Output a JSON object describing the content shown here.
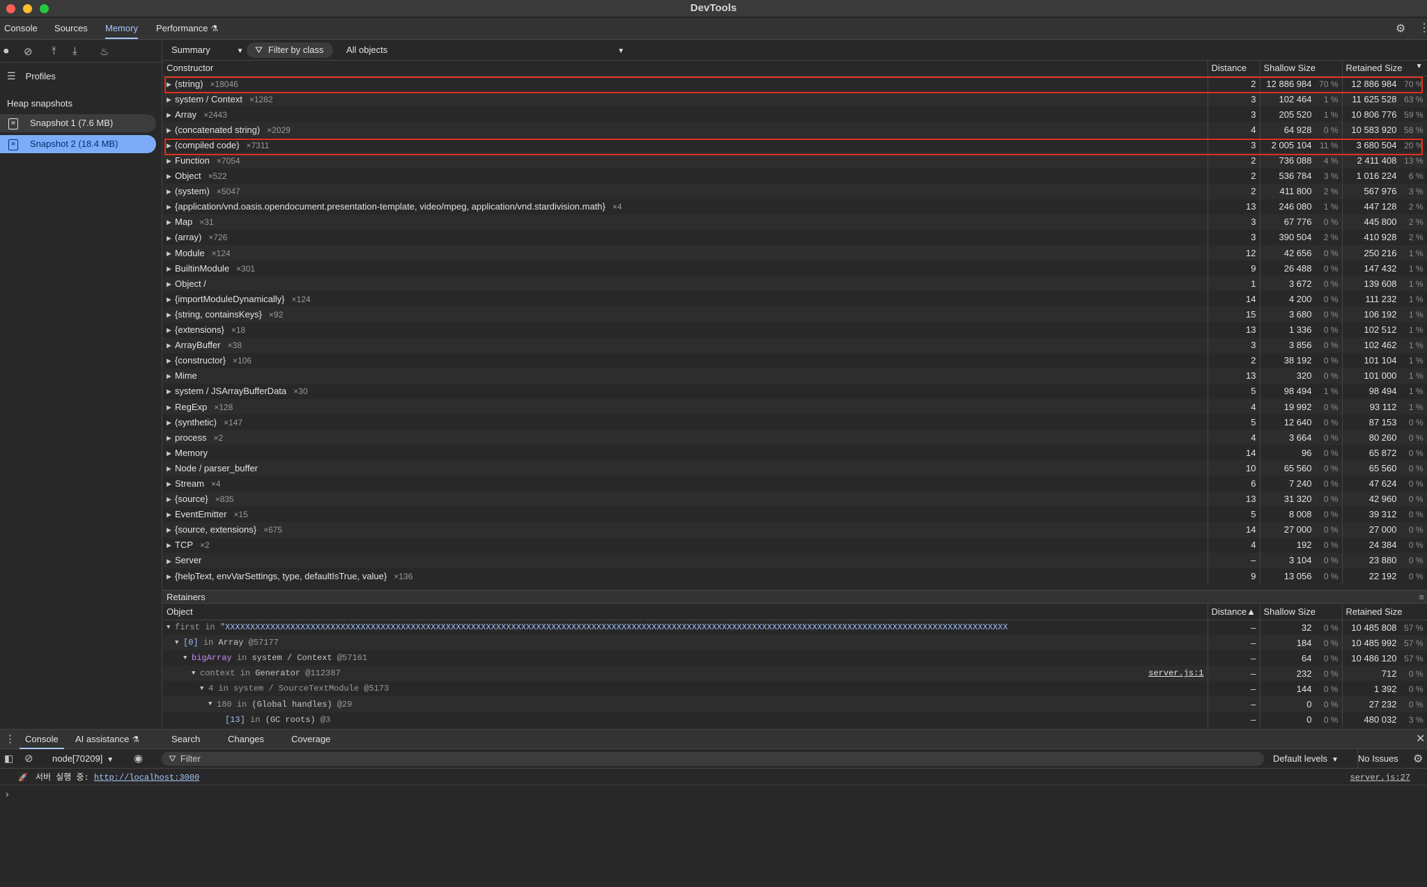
{
  "window": {
    "title": "DevTools"
  },
  "tabs": [
    "Console",
    "Sources",
    "Memory",
    "Performance"
  ],
  "sidebar": {
    "profiles_label": "Profiles",
    "heap_header": "Heap snapshots",
    "snapshots": [
      "Snapshot 1 (7.6 MB)",
      "Snapshot 2 (18.4 MB)"
    ]
  },
  "toolbar": {
    "view": "Summary",
    "filter": "Filter by class",
    "objects": "All objects"
  },
  "summary": {
    "headers": {
      "constructor": "Constructor",
      "distance": "Distance",
      "shallow": "Shallow Size",
      "retained": "Retained Size"
    },
    "rows": [
      {
        "name": "(string)",
        "count": "×18046",
        "distance": "2",
        "shallow": "12 886 984",
        "shallow_pct": "70 %",
        "retained": "12 886 984",
        "retained_pct": "70 %"
      },
      {
        "name": "system / Context",
        "count": "×1282",
        "distance": "3",
        "shallow": "102 464",
        "shallow_pct": "1 %",
        "retained": "11 625 528",
        "retained_pct": "63 %"
      },
      {
        "name": "Array",
        "count": "×2443",
        "distance": "3",
        "shallow": "205 520",
        "shallow_pct": "1 %",
        "retained": "10 806 776",
        "retained_pct": "59 %"
      },
      {
        "name": "(concatenated string)",
        "count": "×2029",
        "distance": "4",
        "shallow": "64 928",
        "shallow_pct": "0 %",
        "retained": "10 583 920",
        "retained_pct": "58 %"
      },
      {
        "name": "(compiled code)",
        "count": "×7311",
        "distance": "3",
        "shallow": "2 005 104",
        "shallow_pct": "11 %",
        "retained": "3 680 504",
        "retained_pct": "20 %"
      },
      {
        "name": "Function",
        "count": "×7054",
        "distance": "2",
        "shallow": "736 088",
        "shallow_pct": "4 %",
        "retained": "2 411 408",
        "retained_pct": "13 %"
      },
      {
        "name": "Object",
        "count": "×522",
        "distance": "2",
        "shallow": "536 784",
        "shallow_pct": "3 %",
        "retained": "1 016 224",
        "retained_pct": "6 %"
      },
      {
        "name": "(system)",
        "count": "×5047",
        "distance": "2",
        "shallow": "411 800",
        "shallow_pct": "2 %",
        "retained": "567 976",
        "retained_pct": "3 %"
      },
      {
        "name": "{application/vnd.oasis.opendocument.presentation-template, video/mpeg, application/vnd.stardivision.math}",
        "count": "×4",
        "distance": "13",
        "shallow": "246 080",
        "shallow_pct": "1 %",
        "retained": "447 128",
        "retained_pct": "2 %"
      },
      {
        "name": "Map",
        "count": "×31",
        "distance": "3",
        "shallow": "67 776",
        "shallow_pct": "0 %",
        "retained": "445 800",
        "retained_pct": "2 %"
      },
      {
        "name": "(array)",
        "count": "×726",
        "distance": "3",
        "shallow": "390 504",
        "shallow_pct": "2 %",
        "retained": "410 928",
        "retained_pct": "2 %"
      },
      {
        "name": "Module",
        "count": "×124",
        "distance": "12",
        "shallow": "42 656",
        "shallow_pct": "0 %",
        "retained": "250 216",
        "retained_pct": "1 %"
      },
      {
        "name": "BuiltinModule",
        "count": "×301",
        "distance": "9",
        "shallow": "26 488",
        "shallow_pct": "0 %",
        "retained": "147 432",
        "retained_pct": "1 %"
      },
      {
        "name": "Object /",
        "count": "",
        "distance": "1",
        "shallow": "3 672",
        "shallow_pct": "0 %",
        "retained": "139 608",
        "retained_pct": "1 %"
      },
      {
        "name": "{importModuleDynamically}",
        "count": "×124",
        "distance": "14",
        "shallow": "4 200",
        "shallow_pct": "0 %",
        "retained": "111 232",
        "retained_pct": "1 %"
      },
      {
        "name": "{string, containsKeys}",
        "count": "×92",
        "distance": "15",
        "shallow": "3 680",
        "shallow_pct": "0 %",
        "retained": "106 192",
        "retained_pct": "1 %"
      },
      {
        "name": "{extensions}",
        "count": "×18",
        "distance": "13",
        "shallow": "1 336",
        "shallow_pct": "0 %",
        "retained": "102 512",
        "retained_pct": "1 %"
      },
      {
        "name": "ArrayBuffer",
        "count": "×38",
        "distance": "3",
        "shallow": "3 856",
        "shallow_pct": "0 %",
        "retained": "102 462",
        "retained_pct": "1 %"
      },
      {
        "name": "{constructor}",
        "count": "×106",
        "distance": "2",
        "shallow": "38 192",
        "shallow_pct": "0 %",
        "retained": "101 104",
        "retained_pct": "1 %"
      },
      {
        "name": "Mime",
        "count": "",
        "distance": "13",
        "shallow": "320",
        "shallow_pct": "0 %",
        "retained": "101 000",
        "retained_pct": "1 %"
      },
      {
        "name": "system / JSArrayBufferData",
        "count": "×30",
        "distance": "5",
        "shallow": "98 494",
        "shallow_pct": "1 %",
        "retained": "98 494",
        "retained_pct": "1 %"
      },
      {
        "name": "RegExp",
        "count": "×128",
        "distance": "4",
        "shallow": "19 992",
        "shallow_pct": "0 %",
        "retained": "93 112",
        "retained_pct": "1 %"
      },
      {
        "name": "(synthetic)",
        "count": "×147",
        "distance": "5",
        "shallow": "12 640",
        "shallow_pct": "0 %",
        "retained": "87 153",
        "retained_pct": "0 %"
      },
      {
        "name": "process",
        "count": "×2",
        "distance": "4",
        "shallow": "3 664",
        "shallow_pct": "0 %",
        "retained": "80 260",
        "retained_pct": "0 %"
      },
      {
        "name": "Memory",
        "count": "",
        "distance": "14",
        "shallow": "96",
        "shallow_pct": "0 %",
        "retained": "65 872",
        "retained_pct": "0 %"
      },
      {
        "name": "Node / parser_buffer",
        "count": "",
        "distance": "10",
        "shallow": "65 560",
        "shallow_pct": "0 %",
        "retained": "65 560",
        "retained_pct": "0 %"
      },
      {
        "name": "Stream",
        "count": "×4",
        "distance": "6",
        "shallow": "7 240",
        "shallow_pct": "0 %",
        "retained": "47 624",
        "retained_pct": "0 %"
      },
      {
        "name": "{source}",
        "count": "×835",
        "distance": "13",
        "shallow": "31 320",
        "shallow_pct": "0 %",
        "retained": "42 960",
        "retained_pct": "0 %"
      },
      {
        "name": "EventEmitter",
        "count": "×15",
        "distance": "5",
        "shallow": "8 008",
        "shallow_pct": "0 %",
        "retained": "39 312",
        "retained_pct": "0 %"
      },
      {
        "name": "{source, extensions}",
        "count": "×675",
        "distance": "14",
        "shallow": "27 000",
        "shallow_pct": "0 %",
        "retained": "27 000",
        "retained_pct": "0 %"
      },
      {
        "name": "TCP",
        "count": "×2",
        "distance": "4",
        "shallow": "192",
        "shallow_pct": "0 %",
        "retained": "24 384",
        "retained_pct": "0 %"
      },
      {
        "name": "Server",
        "count": "",
        "distance": "–",
        "shallow": "3 104",
        "shallow_pct": "0 %",
        "retained": "23 880",
        "retained_pct": "0 %"
      },
      {
        "name": "{helpText, envVarSettings, type, defaultIsTrue, value}",
        "count": "×136",
        "distance": "9",
        "shallow": "13 056",
        "shallow_pct": "0 %",
        "retained": "22 192",
        "retained_pct": "0 %"
      }
    ]
  },
  "retainers": {
    "title": "Retainers",
    "headers": {
      "object": "Object",
      "distance": "Distance▲",
      "shallow": "Shallow Size",
      "retained": "Retained Size"
    },
    "rows": [
      {
        "key": "first",
        "in": "in",
        "target": "\"XXXXXXXXXXXXXXXXXXXXXXXXXXXXXXXXXXXXXXXXXXXXXXXXXXXXXXXXXXXXXXXXXXXXXXXXXXXXXXXXXXXXXXXXXXXXXXXXXXXXXXXXXXXXXXXXXXXXXXXXXXXXXXXXXXXXXXXXXXXXXXXXXXXXXXXXXXXX",
        "id": "",
        "src": "",
        "distance": "–",
        "shallow": "32",
        "shallow_pct": "0 %",
        "retained": "10 485 808",
        "retained_pct": "57 %"
      },
      {
        "key": "[0]",
        "in": "in",
        "target": "Array",
        "id": "@57177",
        "src": "",
        "distance": "–",
        "shallow": "184",
        "shallow_pct": "0 %",
        "retained": "10 485 992",
        "retained_pct": "57 %"
      },
      {
        "key": "bigArray",
        "in": "in",
        "target": "system / Context",
        "id": "@57161",
        "src": "",
        "distance": "–",
        "shallow": "64",
        "shallow_pct": "0 %",
        "retained": "10 486 120",
        "retained_pct": "57 %"
      },
      {
        "key": "context",
        "in": "in",
        "target": "Generator",
        "id": "@112387",
        "src": "server.js:1",
        "distance": "–",
        "shallow": "232",
        "shallow_pct": "0 %",
        "retained": "712",
        "retained_pct": "0 %"
      },
      {
        "key": "4",
        "in": "in",
        "target": "system / SourceTextModule",
        "id": "@5173",
        "src": "",
        "distance": "–",
        "shallow": "144",
        "shallow_pct": "0 %",
        "retained": "1 392",
        "retained_pct": "0 %"
      },
      {
        "key": "180",
        "in": "in",
        "target": "(Global handles)",
        "id": "@29",
        "src": "",
        "distance": "–",
        "shallow": "0",
        "shallow_pct": "0 %",
        "retained": "27 232",
        "retained_pct": "0 %"
      },
      {
        "key": "[13]",
        "in": "in",
        "target": "(GC roots)",
        "id": "@3",
        "src": "",
        "distance": "–",
        "shallow": "0",
        "shallow_pct": "0 %",
        "retained": "480 032",
        "retained_pct": "3 %"
      }
    ]
  },
  "drawer": {
    "tabs": [
      "Console",
      "AI assistance",
      "Search",
      "Changes",
      "Coverage"
    ],
    "context": "node[70209]",
    "filter_placeholder": "Filter",
    "levels": "Default levels",
    "issues": "No Issues",
    "log": {
      "emoji": "🚀",
      "text": "서버 실행 중: ",
      "link": "http://localhost:3000",
      "source": "server.js:27"
    }
  }
}
